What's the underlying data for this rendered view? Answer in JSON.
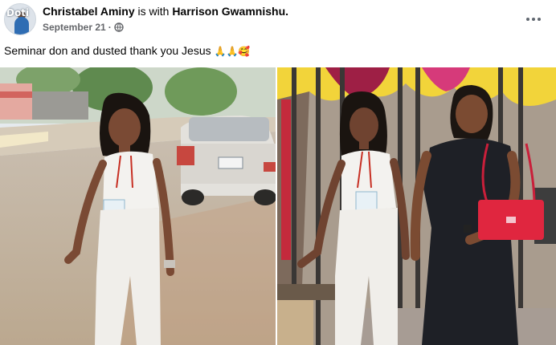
{
  "post": {
    "author": "Christabel Aminy",
    "with_text": "is with",
    "tagged": "Harrison Gwamnishu.",
    "avatar_text": "Doti",
    "date": "September 21",
    "separator": "·",
    "privacy_icon": "globe-icon",
    "more_icon": "more-options-icon",
    "caption": "Seminar don and dusted thank you Jesus",
    "caption_emojis": [
      "🙏",
      "🙏",
      "🥰"
    ]
  },
  "photos": [
    {
      "name": "photo-woman-street",
      "description_icon": "photo"
    },
    {
      "name": "photo-two-women-gate",
      "description_icon": "photo"
    }
  ],
  "colors": {
    "text_primary": "#050505",
    "text_secondary": "#65676b"
  }
}
